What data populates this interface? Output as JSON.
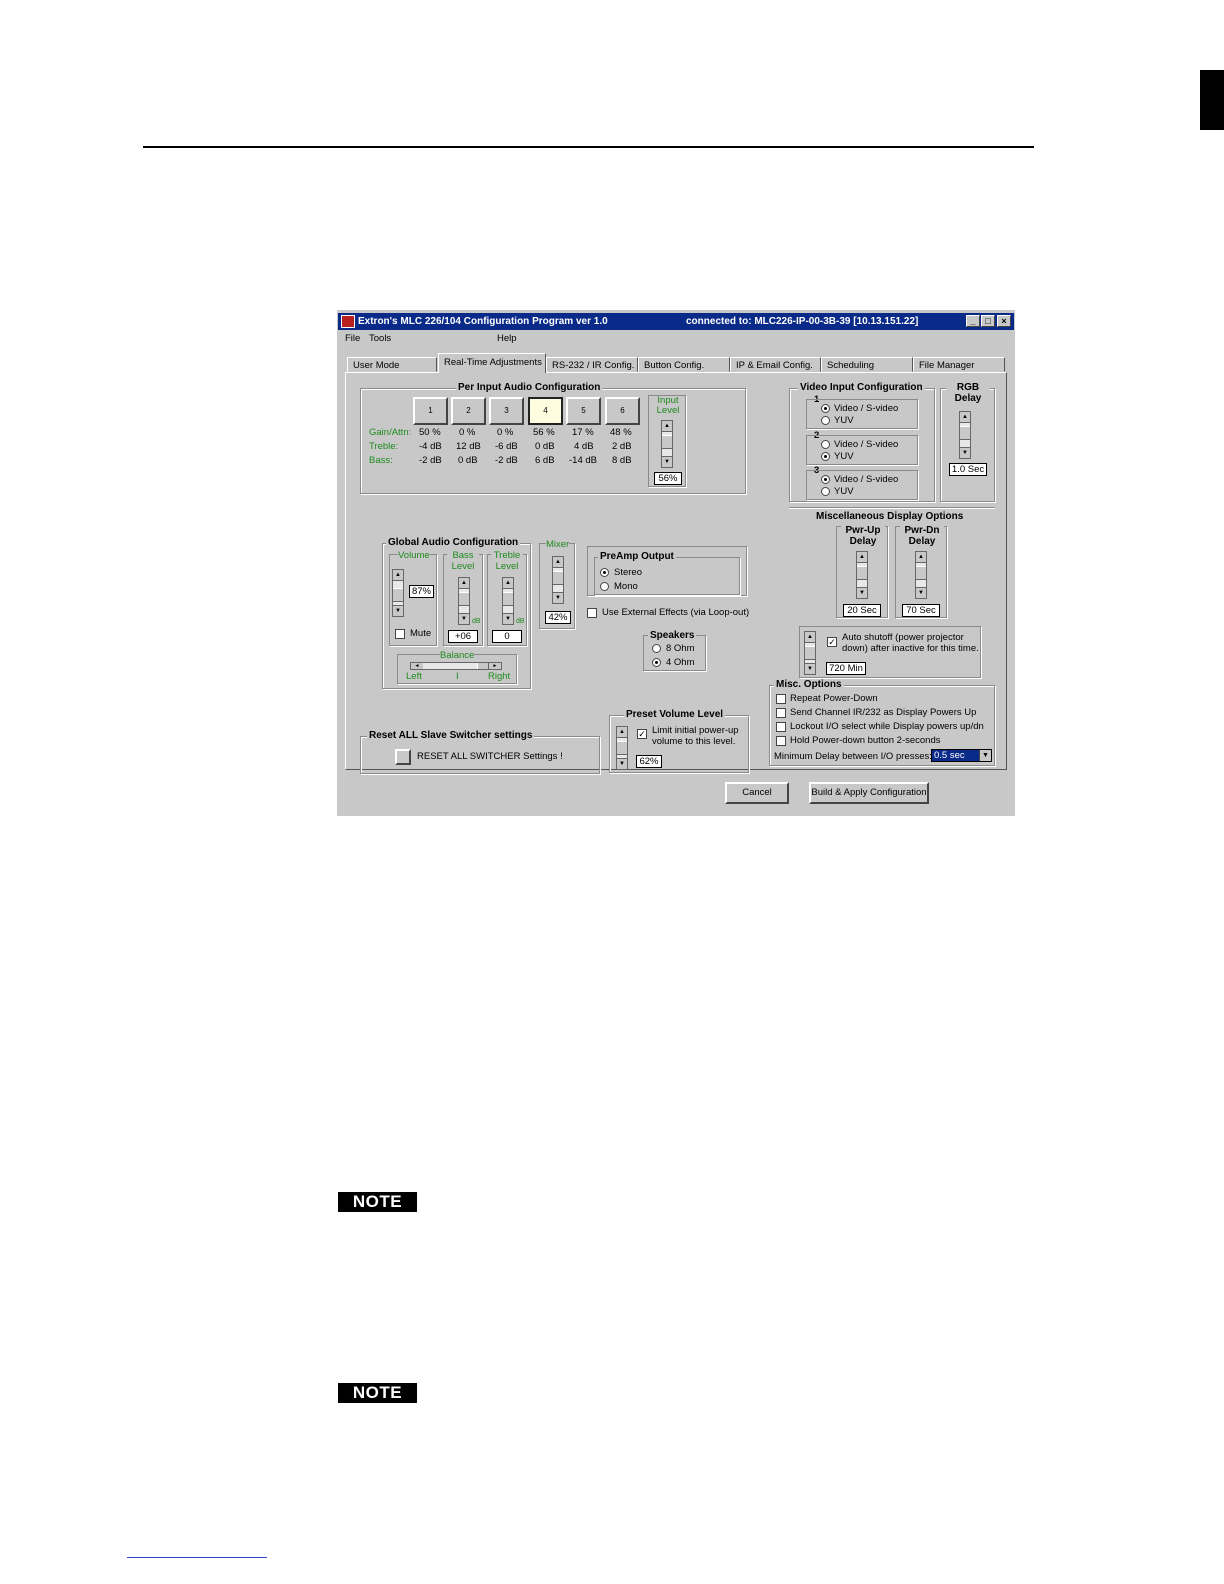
{
  "app": {
    "title": "Extron's MLC 226/104 Configuration Program    ver 1.0",
    "connection": "connected to:  MLC226-IP-00-3B-39  [10.13.151.22]",
    "menu": [
      "File",
      "Tools",
      "Help"
    ],
    "window_buttons": [
      "_",
      "□",
      "×"
    ],
    "tabs": [
      "User Mode",
      "Real-Time Adjustments",
      "RS-232 / IR Config.",
      "Button Config.",
      "IP  &  Email Config.",
      "Scheduling",
      "File Manager"
    ],
    "active_tab": "Real-Time Adjustments"
  },
  "per_input": {
    "title": "Per Input Audio Configuration",
    "row_labels": [
      "Gain/Attn:",
      "Treble:",
      "Bass:"
    ],
    "inputs": [
      {
        "label": "1",
        "gain": "50 %",
        "treble": "-4 dB",
        "bass": "-2 dB"
      },
      {
        "label": "2",
        "gain": "0 %",
        "treble": "12 dB",
        "bass": "0 dB"
      },
      {
        "label": "3",
        "gain": "0 %",
        "treble": "-6 dB",
        "bass": "-2 dB"
      },
      {
        "label": "4",
        "gain": "56 %",
        "treble": "0 dB",
        "bass": "6 dB"
      },
      {
        "label": "5",
        "gain": "17 %",
        "treble": "4 dB",
        "bass": "-14 dB"
      },
      {
        "label": "6",
        "gain": "48 %",
        "treble": "2 dB",
        "bass": "8 dB"
      }
    ],
    "selected_input": "4",
    "input_level_label": "Input Level",
    "input_level_value": "56%"
  },
  "global_audio": {
    "title": "Global Audio Configuration",
    "volume_label": "Volume",
    "volume_value": "87%",
    "bass_label": "Bass Level",
    "bass_value": "+06",
    "treble_label": "Treble Level",
    "treble_value": "0",
    "db_unit": "dB",
    "mute_label": "Mute",
    "balance_label": "Balance",
    "balance_left": "Left",
    "balance_center": "I",
    "balance_right": "Right"
  },
  "mixer": {
    "label": "Mixer",
    "value": "42%"
  },
  "preamp": {
    "title": "PreAmp Output",
    "options": [
      "Stereo",
      "Mono"
    ],
    "selected": "Stereo"
  },
  "external_effects": {
    "label": "Use External Effects (via Loop-out)",
    "checked": false
  },
  "speakers": {
    "title": "Speakers",
    "options": [
      "8 Ohm",
      "4 Ohm"
    ],
    "selected": "4 Ohm"
  },
  "video_input": {
    "title": "Video Input Configuration",
    "inputs": [
      {
        "num": "1",
        "options": [
          "Video / S-video",
          "YUV"
        ],
        "selected": "Video / S-video"
      },
      {
        "num": "2",
        "options": [
          "Video / S-video",
          "YUV"
        ],
        "selected": "YUV"
      },
      {
        "num": "3",
        "options": [
          "Video / S-video",
          "YUV"
        ],
        "selected": "Video / S-video"
      }
    ]
  },
  "rgb_delay": {
    "label": "RGB Delay",
    "value": "1.0 Sec"
  },
  "misc_display": {
    "title": "Miscellaneous Display Options",
    "pwr_up_label": "Pwr-Up Delay",
    "pwr_up_value": "20 Sec",
    "pwr_dn_label": "Pwr-Dn Delay",
    "pwr_dn_value": "70 Sec",
    "auto_shutoff_label": "Auto shutoff (power projector down) after inactive for this time.",
    "auto_shutoff_checked": true,
    "auto_shutoff_value": "720 Min"
  },
  "misc_options": {
    "title": "Misc. Options",
    "items": [
      "Repeat Power-Down",
      "Send Channel IR/232 as Display Powers Up",
      "Lockout I/O select while Display powers up/dn",
      "Hold Power-down button 2-seconds"
    ],
    "min_delay_label": "Minimum Delay between I/O presses:",
    "min_delay_value": "0.5 sec"
  },
  "reset": {
    "title": "Reset ALL Slave Switcher settings",
    "button_label": "RESET ALL SWITCHER Settings !"
  },
  "preset_volume": {
    "title": "Preset Volume Level",
    "label": "Limit initial power-up volume to this level.",
    "checked": true,
    "value": "62%"
  },
  "footer_buttons": {
    "cancel": "Cancel",
    "build": "Build & Apply Configuration"
  },
  "notes": [
    "NOTE",
    "NOTE"
  ]
}
